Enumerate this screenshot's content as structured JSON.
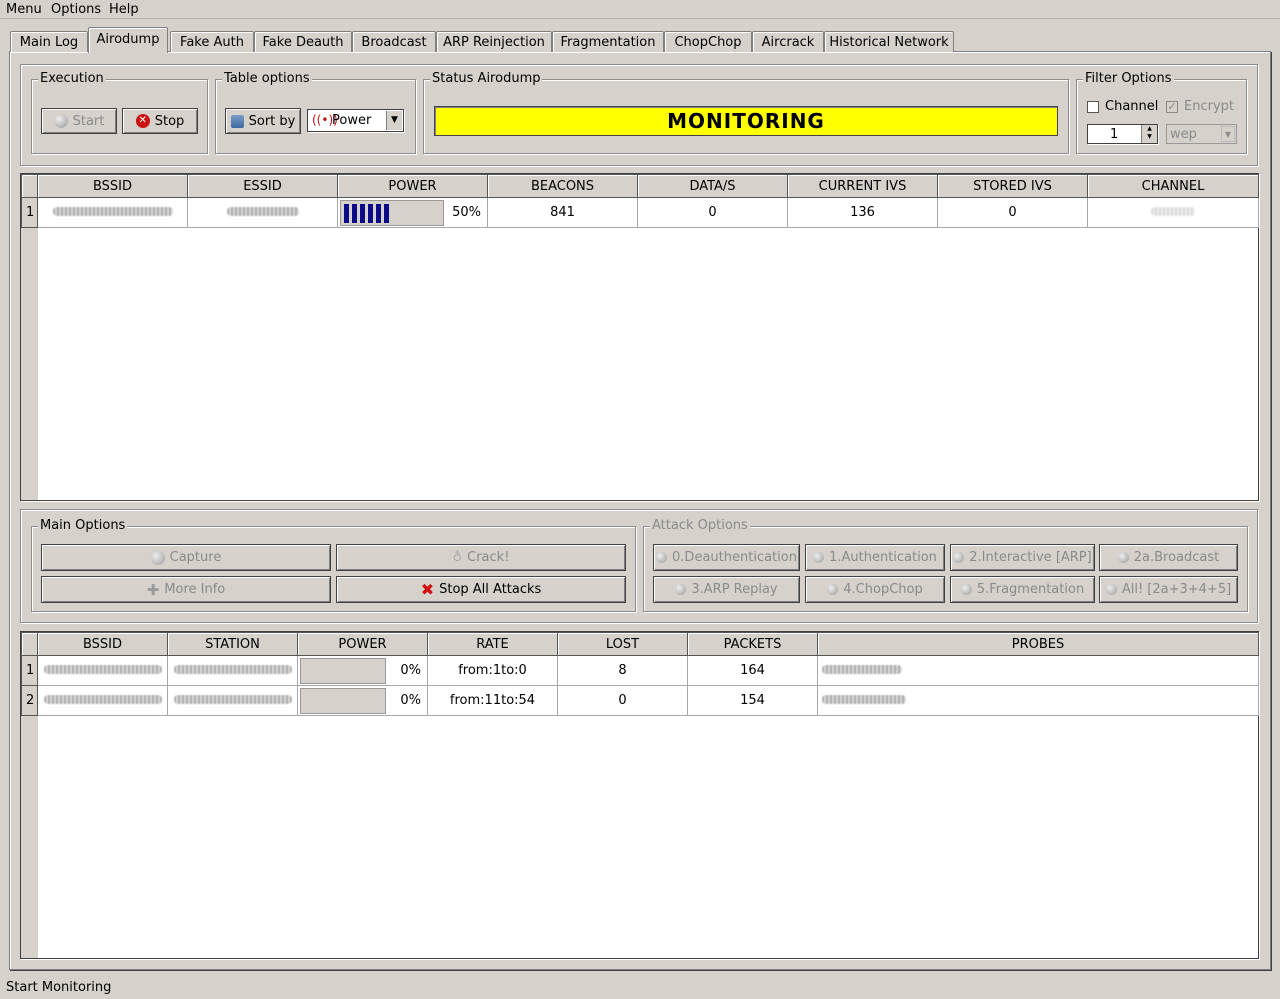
{
  "menu": {
    "items": [
      "Menu",
      "Options",
      "Help"
    ]
  },
  "tabs": [
    "Main Log",
    "Airodump",
    "Fake Auth",
    "Fake Deauth",
    "Broadcast",
    "ARP Reinjection",
    "Fragmentation",
    "ChopChop",
    "Aircrack",
    "Historical Network"
  ],
  "active_tab": "Airodump",
  "execution": {
    "title": "Execution",
    "start": "Start",
    "stop": "Stop"
  },
  "table_options": {
    "title": "Table options",
    "sort_by": "Sort by",
    "sort_value": "Power"
  },
  "status": {
    "title": "Status Airodump",
    "text": "MONITORING",
    "color": "#ffff00"
  },
  "filter": {
    "title": "Filter Options",
    "channel_label": "Channel",
    "channel_checked": false,
    "encrypt_label": "Encrypt",
    "encrypt_checked": true,
    "channel_value": "1",
    "encrypt_value": "wep"
  },
  "ap_table": {
    "headers": [
      "BSSID",
      "ESSID",
      "POWER",
      "BEACONS",
      "DATA/S",
      "CURRENT IVS",
      "STORED IVS",
      "CHANNEL"
    ],
    "rows": [
      {
        "index": "1",
        "power": "50%",
        "power_level": 0.5,
        "beacons": "841",
        "data_s": "0",
        "current_ivs": "136",
        "stored_ivs": "0"
      }
    ]
  },
  "main_options": {
    "title": "Main Options",
    "capture": "Capture",
    "crack": "Crack!",
    "more_info": "More Info",
    "stop_all": "Stop All Attacks"
  },
  "attack_options": {
    "title": "Attack Options",
    "buttons": [
      "0.Deauthentication",
      "1.Authentication",
      "2.Interactive [ARP]",
      "2a.Broadcast",
      "3.ARP Replay",
      "4.ChopChop",
      "5.Fragmentation",
      "All! [2a+3+4+5]"
    ]
  },
  "station_table": {
    "headers": [
      "BSSID",
      "STATION",
      "POWER",
      "RATE",
      "LOST",
      "PACKETS",
      "PROBES"
    ],
    "rows": [
      {
        "index": "1",
        "power": "0%",
        "power_level": 0,
        "rate": "from:1to:0",
        "lost": "8",
        "packets": "164"
      },
      {
        "index": "2",
        "power": "0%",
        "power_level": 0,
        "rate": "from:11to:54",
        "lost": "0",
        "packets": "154"
      }
    ]
  },
  "statusbar": {
    "text": "Start Monitoring"
  }
}
